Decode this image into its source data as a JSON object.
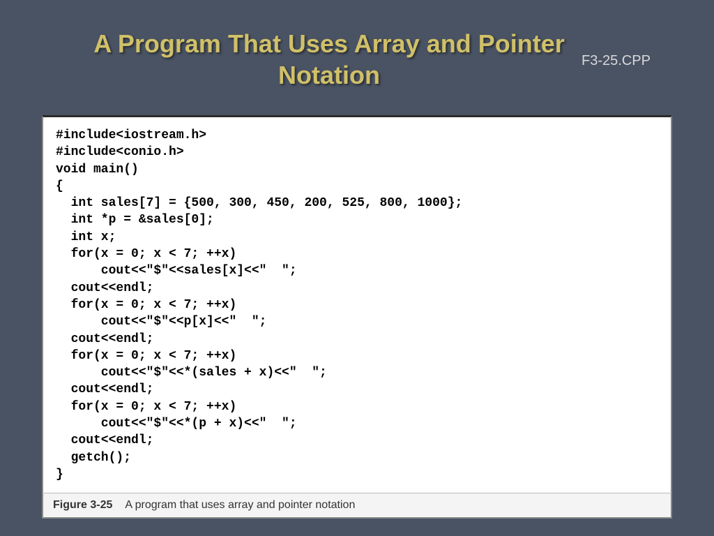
{
  "title": "A Program That Uses Array and Pointer Notation",
  "filename": "F3-25.CPP",
  "code": "#include<iostream.h>\n#include<conio.h>\nvoid main()\n{\n  int sales[7] = {500, 300, 450, 200, 525, 800, 1000};\n  int *p = &sales[0];\n  int x;\n  for(x = 0; x < 7; ++x)\n      cout<<\"$\"<<sales[x]<<\"  \";\n  cout<<endl;\n  for(x = 0; x < 7; ++x)\n      cout<<\"$\"<<p[x]<<\"  \";\n  cout<<endl;\n  for(x = 0; x < 7; ++x)\n      cout<<\"$\"<<*(sales + x)<<\"  \";\n  cout<<endl;\n  for(x = 0; x < 7; ++x)\n      cout<<\"$\"<<*(p + x)<<\"  \";\n  cout<<endl;\n  getch();\n}",
  "caption_label": "Figure 3-25",
  "caption_text": "A program that uses array and pointer notation"
}
